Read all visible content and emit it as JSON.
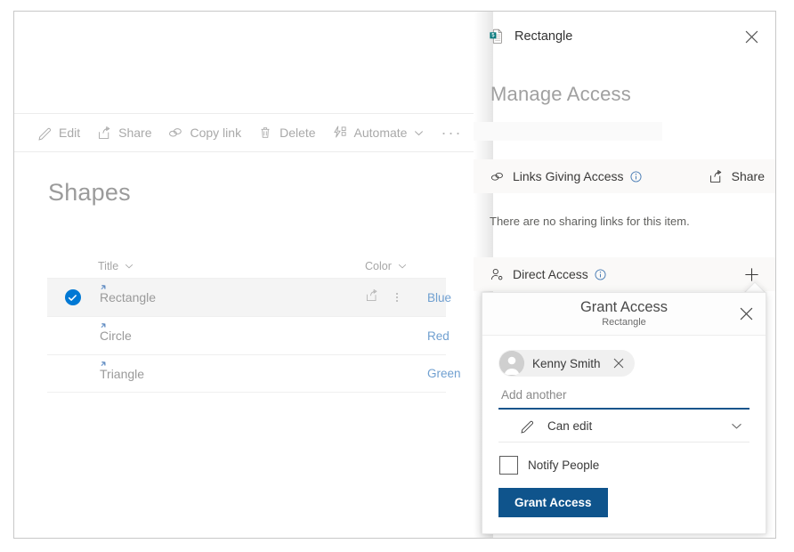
{
  "list_view": {
    "command_bar": {
      "items": [
        {
          "label": "Edit",
          "icon": "pencil-icon"
        },
        {
          "label": "Share",
          "icon": "share-icon"
        },
        {
          "label": "Copy link",
          "icon": "link-icon"
        },
        {
          "label": "Delete",
          "icon": "trash-icon"
        },
        {
          "label": "Automate",
          "icon": "automate-icon",
          "has_chevron": true
        }
      ],
      "overflow_label": "···"
    },
    "title": "Shapes",
    "columns": [
      {
        "label": "Title",
        "sortable": true
      },
      {
        "label": "Color",
        "sortable": true
      }
    ],
    "rows": [
      {
        "title": "Rectangle",
        "color": "Blue",
        "selected": true
      },
      {
        "title": "Circle",
        "color": "Red",
        "selected": false
      },
      {
        "title": "Triangle",
        "color": "Green",
        "selected": false
      }
    ],
    "row_actions": {
      "share_icon": "share-icon",
      "more_icon": "more-vertical-icon"
    }
  },
  "panel": {
    "header": {
      "icon": "sharepoint-list-item-icon",
      "title": "Rectangle",
      "close_label": "✕"
    },
    "heading": "Manage Access",
    "links_section": {
      "label": "Links Giving Access",
      "icon": "link-icon",
      "info_icon": "info-icon",
      "action_label": "Share",
      "action_icon": "share-icon",
      "empty_message": "There are no sharing links for this item."
    },
    "direct_section": {
      "label": "Direct Access",
      "icon": "person-add-icon",
      "info_icon": "info-icon",
      "add_label": "+"
    },
    "ghost_rows": {
      "row_1": "Links Giving Access",
      "row_2": "Direct Access"
    }
  },
  "grant_access_callout": {
    "title": "Grant Access",
    "subtitle": "Rectangle",
    "close_label": "✕",
    "people": [
      {
        "name": "Kenny Smith",
        "remove_label": "✕",
        "avatar_icon": "person-avatar-icon"
      }
    ],
    "add_another_placeholder": "Add another",
    "permission": {
      "label": "Can edit",
      "icon": "pencil-icon",
      "chevron_icon": "chevron-down-icon"
    },
    "notify": {
      "label": "Notify People",
      "checked": false
    },
    "submit_label": "Grant Access"
  },
  "colors": {
    "accent_blue": "#0078d4",
    "primary_button": "#0f548c",
    "link_text": "#6f9fd0",
    "section_bg": "#faf9f8",
    "selected_row_bg": "#f4f4f4"
  }
}
